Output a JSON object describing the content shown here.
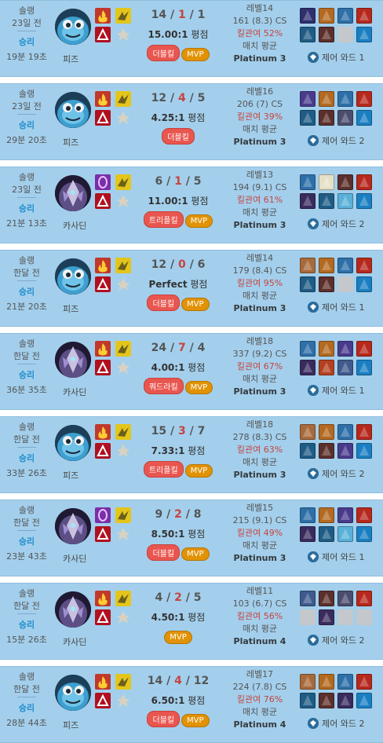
{
  "matches": [
    {
      "queue": "솔랭",
      "ago": "23일 전",
      "result": "승리",
      "duration": "19분 19초",
      "champion": "피즈",
      "champ_icon": "fizz-portrait",
      "spells": [
        "ignite",
        "flash",
        "exhaust",
        "passive-rune"
      ],
      "spell_colors": [
        "#c0392b",
        "#b01020",
        "#e3c51b",
        "#8a8a8a"
      ],
      "kda": {
        "k": "14",
        "d": "1",
        "a": "1"
      },
      "ratio": "15.00:1",
      "ratio_suffix": "평점",
      "badges": [
        {
          "text": "더블킬",
          "kind": "multi"
        },
        {
          "text": "MVP",
          "kind": "mvp"
        }
      ],
      "level": "레벨14",
      "cs": "161 (8.3) CS",
      "kill_participation": "킬관여 52%",
      "match_avg": "매치 평균",
      "tier": "Platinum 3",
      "items": [
        "#2d2f6e",
        "#b36920",
        "#2e6fa8",
        "#b7281c",
        "#1f5c85",
        "#5b2f2b",
        "",
        "#1a7fc2"
      ],
      "ward_text": "제어 와드 1"
    },
    {
      "queue": "솔랭",
      "ago": "23일 전",
      "result": "승리",
      "duration": "29분 20초",
      "champion": "피즈",
      "champ_icon": "fizz-portrait",
      "spells": [
        "ignite",
        "flash",
        "exhaust",
        "passive-rune"
      ],
      "spell_colors": [
        "#c0392b",
        "#b01020",
        "#e3c51b",
        "#8a8a8a"
      ],
      "kda": {
        "k": "12",
        "d": "4",
        "a": "5"
      },
      "ratio": "4.25:1",
      "ratio_suffix": "평점",
      "badges": [
        {
          "text": "더블킬",
          "kind": "multi"
        }
      ],
      "level": "레벨16",
      "cs": "206 (7) CS",
      "kill_participation": "킬관여 39%",
      "match_avg": "매치 평균",
      "tier": "Platinum 3",
      "items": [
        "#4a3a8c",
        "#b36920",
        "#2e6fa8",
        "#b7281c",
        "#1f5c85",
        "#5b2f2b",
        "#4b4d6e",
        "#1a7fc2"
      ],
      "ward_text": "제어 와드 2"
    },
    {
      "queue": "솔랭",
      "ago": "23일 전",
      "result": "승리",
      "duration": "21분 13초",
      "champion": "카사딘",
      "champ_icon": "kassadin-portrait",
      "spells": [
        "teleport",
        "flash",
        "exhaust",
        "passive-rune"
      ],
      "spell_colors": [
        "#7a2ea8",
        "#b01020",
        "#e3c51b",
        "#8a8a8a"
      ],
      "kda": {
        "k": "6",
        "d": "1",
        "a": "5"
      },
      "ratio": "11.00:1",
      "ratio_suffix": "평점",
      "badges": [
        {
          "text": "트리플킬",
          "kind": "multi"
        },
        {
          "text": "MVP",
          "kind": "mvp"
        }
      ],
      "level": "레벨13",
      "cs": "194 (9.1) CS",
      "kill_participation": "킬관여 61%",
      "match_avg": "매치 평균",
      "tier": "Platinum 3",
      "items": [
        "#2e6fa8",
        "#e4e0c8",
        "#5b2f2b",
        "#b7281c",
        "#3a2b5e",
        "#1f5c85",
        "#59b0d8",
        "#1a7fc2"
      ],
      "ward_text": "제어 와드 2"
    },
    {
      "queue": "솔랭",
      "ago": "한달 전",
      "result": "승리",
      "duration": "21분 20초",
      "champion": "피즈",
      "champ_icon": "fizz-portrait",
      "spells": [
        "ignite",
        "flash",
        "exhaust",
        "passive-rune"
      ],
      "spell_colors": [
        "#c0392b",
        "#b01020",
        "#e3c51b",
        "#8a8a8a"
      ],
      "kda": {
        "k": "12",
        "d": "0",
        "a": "6"
      },
      "ratio": "Perfect",
      "ratio_suffix": "평점",
      "badges": [
        {
          "text": "더블킬",
          "kind": "multi"
        },
        {
          "text": "MVP",
          "kind": "mvp"
        }
      ],
      "level": "레벨14",
      "cs": "179 (8.4) CS",
      "kill_participation": "킬관여 95%",
      "match_avg": "매치 평균",
      "tier": "Platinum 3",
      "items": [
        "#a86a3a",
        "#b36920",
        "#2e6fa8",
        "#b7281c",
        "#1f5c85",
        "#5b2f2b",
        "",
        "#1a7fc2"
      ],
      "ward_text": "제어 와드 1"
    },
    {
      "queue": "솔랭",
      "ago": "한달 전",
      "result": "승리",
      "duration": "36분 35초",
      "champion": "카사딘",
      "champ_icon": "kassadin-portrait",
      "spells": [
        "ignite",
        "flash",
        "exhaust",
        "passive-rune"
      ],
      "spell_colors": [
        "#c0392b",
        "#b01020",
        "#e3c51b",
        "#8a8a8a"
      ],
      "kda": {
        "k": "24",
        "d": "7",
        "a": "4"
      },
      "ratio": "4.00:1",
      "ratio_suffix": "평점",
      "badges": [
        {
          "text": "쿼드라킬",
          "kind": "multi"
        },
        {
          "text": "MVP",
          "kind": "mvp"
        }
      ],
      "level": "레벨18",
      "cs": "337 (9.2) CS",
      "kill_participation": "킬관여 67%",
      "match_avg": "매치 평균",
      "tier": "Platinum 3",
      "items": [
        "#2e6fa8",
        "#b36920",
        "#4a3a8c",
        "#b7281c",
        "#3a2b5e",
        "#b34020",
        "#3f5a8c",
        "#1a7fc2"
      ],
      "ward_text": "제어 와드 1"
    },
    {
      "queue": "솔랭",
      "ago": "한달 전",
      "result": "승리",
      "duration": "33분 26초",
      "champion": "피즈",
      "champ_icon": "fizz-portrait",
      "spells": [
        "ignite",
        "flash",
        "exhaust",
        "passive-rune"
      ],
      "spell_colors": [
        "#c0392b",
        "#b01020",
        "#e3c51b",
        "#8a8a8a"
      ],
      "kda": {
        "k": "15",
        "d": "3",
        "a": "7"
      },
      "ratio": "7.33:1",
      "ratio_suffix": "평점",
      "badges": [
        {
          "text": "트리플킬",
          "kind": "multi"
        },
        {
          "text": "MVP",
          "kind": "mvp"
        }
      ],
      "level": "레벨18",
      "cs": "278 (8.3) CS",
      "kill_participation": "킬관여 63%",
      "match_avg": "매치 평균",
      "tier": "Platinum 3",
      "items": [
        "#a86a3a",
        "#b36920",
        "#2e6fa8",
        "#b7281c",
        "#1f5c85",
        "#5b2f2b",
        "#4a3a8c",
        "#1a7fc2"
      ],
      "ward_text": "제어 와드 2"
    },
    {
      "queue": "솔랭",
      "ago": "한달 전",
      "result": "승리",
      "duration": "23분 43초",
      "champion": "카사딘",
      "champ_icon": "kassadin-portrait",
      "spells": [
        "teleport",
        "flash",
        "exhaust",
        "passive-rune"
      ],
      "spell_colors": [
        "#7a2ea8",
        "#b01020",
        "#e3c51b",
        "#8a8a8a"
      ],
      "kda": {
        "k": "9",
        "d": "2",
        "a": "8"
      },
      "ratio": "8.50:1",
      "ratio_suffix": "평점",
      "badges": [
        {
          "text": "더블킬",
          "kind": "multi"
        },
        {
          "text": "MVP",
          "kind": "mvp"
        }
      ],
      "level": "레벨15",
      "cs": "215 (9.1) CS",
      "kill_participation": "킬관여 49%",
      "match_avg": "매치 평균",
      "tier": "Platinum 3",
      "items": [
        "#2e6fa8",
        "#b36920",
        "#4a3a8c",
        "#b7281c",
        "#3a2b5e",
        "#1f5c85",
        "#59b0d8",
        "#1a7fc2"
      ],
      "ward_text": "제어 와드 1"
    },
    {
      "queue": "솔랭",
      "ago": "한달 전",
      "result": "승리",
      "duration": "15분 26초",
      "champion": "카사딘",
      "champ_icon": "kassadin-portrait",
      "spells": [
        "ignite",
        "flash",
        "exhaust",
        "passive-rune"
      ],
      "spell_colors": [
        "#c0392b",
        "#b01020",
        "#e3c51b",
        "#8a8a8a"
      ],
      "kda": {
        "k": "4",
        "d": "2",
        "a": "5"
      },
      "ratio": "4.50:1",
      "ratio_suffix": "평점",
      "badges": [
        {
          "text": "MVP",
          "kind": "mvp"
        }
      ],
      "level": "레벨11",
      "cs": "103 (6.7) CS",
      "kill_participation": "킬관여 56%",
      "match_avg": "매치 평균",
      "tier": "Platinum 4",
      "items": [
        "#3f5a8c",
        "#5b2f2b",
        "#4b4d6e",
        "#b7281c",
        "",
        "#3a2b5e",
        "",
        ""
      ],
      "ward_text": "제어 와드 2"
    },
    {
      "queue": "솔랭",
      "ago": "한달 전",
      "result": "승리",
      "duration": "28분 44초",
      "champion": "피즈",
      "champ_icon": "fizz-portrait",
      "spells": [
        "ignite",
        "flash",
        "exhaust",
        "passive-rune"
      ],
      "spell_colors": [
        "#c0392b",
        "#b01020",
        "#e3c51b",
        "#8a8a8a"
      ],
      "kda": {
        "k": "14",
        "d": "4",
        "a": "12"
      },
      "ratio": "6.50:1",
      "ratio_suffix": "평점",
      "badges": [
        {
          "text": "더블킬",
          "kind": "multi"
        },
        {
          "text": "MVP",
          "kind": "mvp"
        }
      ],
      "level": "레벨17",
      "cs": "224 (7.8) CS",
      "kill_participation": "킬관여 76%",
      "match_avg": "매치 평균",
      "tier": "Platinum 4",
      "items": [
        "#a86a3a",
        "#b36920",
        "#2e6fa8",
        "#b7281c",
        "#1f5c85",
        "#5b2f2b",
        "#3a2b5e",
        "#1a7fc2"
      ],
      "ward_text": "제어 와드 2"
    }
  ],
  "colors": {
    "card_bg": "#a3cfec",
    "win": "#1f8ecd",
    "death": "#c6443e",
    "mvp": "#e19205",
    "multikill": "#e8564f"
  }
}
